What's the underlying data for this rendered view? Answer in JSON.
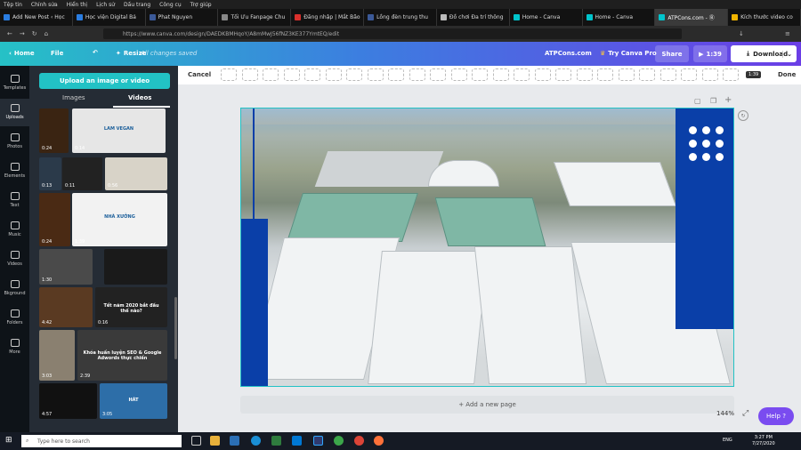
{
  "os_menu": [
    "Tệp tin",
    "Chỉnh sửa",
    "Hiển thị",
    "Lịch sử",
    "Dấu trang",
    "Công cụ",
    "Trợ giúp"
  ],
  "tabs": [
    {
      "title": "Add New Post ‹ Học",
      "color": "#2a7de1"
    },
    {
      "title": "Học viện Digital Bả",
      "color": "#2a7de1"
    },
    {
      "title": "Phat Nguyen",
      "color": "#3b5998"
    },
    {
      "title": "Tối Ưu Fanpage Chu",
      "color": "#888888"
    },
    {
      "title": "Đăng nhập | Mắt Bão",
      "color": "#d9302c"
    },
    {
      "title": "Lồng đèn trung thu",
      "color": "#3b5998"
    },
    {
      "title": "Đồ chơi Đa trí thông",
      "color": "#bbbbbb"
    },
    {
      "title": "Home - Canva",
      "color": "#00c4cc"
    },
    {
      "title": "Home - Canva",
      "color": "#00c4cc"
    },
    {
      "title": "ATPCons.com - Ⓑ",
      "color": "#00c4cc"
    },
    {
      "title": "Kích thước video co",
      "color": "#f0b400"
    }
  ],
  "url": "https://www.canva.com/design/DAEDKBMHqoY/A8mMwJ56fNZ3KE377YmtEQ/edit",
  "topbar": {
    "home": "Home",
    "file": "File",
    "resize": "Resize",
    "saved": "All changes saved",
    "design_name": "ATPCons.com",
    "try_pro": "Try Canva Pro",
    "share": "Share",
    "play": "1:39",
    "download": "Download"
  },
  "timeline": {
    "cancel": "Cancel",
    "done": "Done",
    "duration": "1:39"
  },
  "rail": [
    {
      "label": "Templates",
      "icon": "templates-icon"
    },
    {
      "label": "Uploads",
      "icon": "upload-icon",
      "selected": true
    },
    {
      "label": "Photos",
      "icon": "photos-icon"
    },
    {
      "label": "Elements",
      "icon": "elements-icon"
    },
    {
      "label": "Text",
      "icon": "text-icon"
    },
    {
      "label": "Music",
      "icon": "music-icon"
    },
    {
      "label": "Videos",
      "icon": "videos-icon"
    },
    {
      "label": "Bkground",
      "icon": "background-icon"
    },
    {
      "label": "Folders",
      "icon": "folders-icon"
    },
    {
      "label": "More",
      "icon": "more-icon"
    }
  ],
  "panel": {
    "upload_button": "Upload an image or video",
    "tab_images": "Images",
    "tab_videos": "Videos"
  },
  "thumbs": [
    {
      "dur": "0:24",
      "text": "",
      "bg": "#3a2412"
    },
    {
      "dur": "0:14",
      "text": "LAM VEGAN",
      "bg": "#e6e6e6"
    },
    {
      "dur": "0:13",
      "text": "",
      "bg": "#2b3a4a"
    },
    {
      "dur": "0:11",
      "text": "",
      "bg": "#222222"
    },
    {
      "dur": "0:56",
      "text": "",
      "bg": "#d8d3c8"
    },
    {
      "dur": "0:24",
      "text": "",
      "bg": "#4a2a14"
    },
    {
      "dur": "1:39",
      "text": "NHÀ XƯỞNG",
      "bg": "#f2f2f2"
    },
    {
      "dur": "1:30",
      "text": "",
      "bg": "#4a4a4a"
    },
    {
      "dur": "",
      "text": "",
      "bg": "#1a1a1a"
    },
    {
      "dur": "4:42",
      "text": "",
      "bg": "#5a3a22"
    },
    {
      "dur": "0:16",
      "text": "Tết năm 2020 bắt đầu thế nào?",
      "bg": "#222222"
    },
    {
      "dur": "3:03",
      "text": "",
      "bg": "#8a8070"
    },
    {
      "dur": "2:39",
      "text": "Khóa huấn luyện SEO & Google Adwords thực chiến",
      "bg": "#3a3a3a"
    },
    {
      "dur": "4:57",
      "text": "",
      "bg": "#111111"
    },
    {
      "dur": "3:05",
      "text": "HÁT",
      "bg": "#2d6ea8"
    }
  ],
  "add_page": "+ Add a new page",
  "zoom": "144%",
  "help": "Help ?",
  "taskbar": {
    "search": "Type here to search",
    "lang": "ENG",
    "time": "3:27 PM",
    "date": "7/27/2020"
  },
  "colors": {
    "accent": "#22c2c5",
    "brand_blue": "#0a3fa8",
    "purple": "#7a4cf0"
  }
}
